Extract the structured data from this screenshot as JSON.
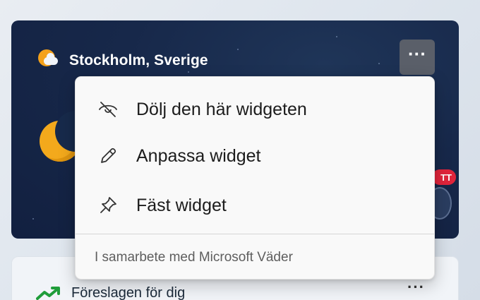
{
  "weather_widget": {
    "location": "Stockholm, Sverige",
    "more_button_label": "···",
    "live_badge": "TT",
    "icon": "weather-sun-cloud-icon"
  },
  "context_menu": {
    "items": [
      {
        "label": "Dölj den här widgeten",
        "icon": "eye-off-icon"
      },
      {
        "label": "Anpassa widget",
        "icon": "pencil-icon"
      },
      {
        "label": "Fäst widget",
        "icon": "pin-icon"
      }
    ],
    "footer": "I samarbete med Microsoft Väder"
  },
  "suggested_widget": {
    "title": "Föreslagen för dig",
    "more_button_label": "···",
    "icon": "trending-up-icon"
  },
  "colors": {
    "weather_card_bg": "#17284a",
    "accent_sun": "#f4a11a",
    "trend_green": "#1f9d3a",
    "badge_red": "#e0243b"
  }
}
